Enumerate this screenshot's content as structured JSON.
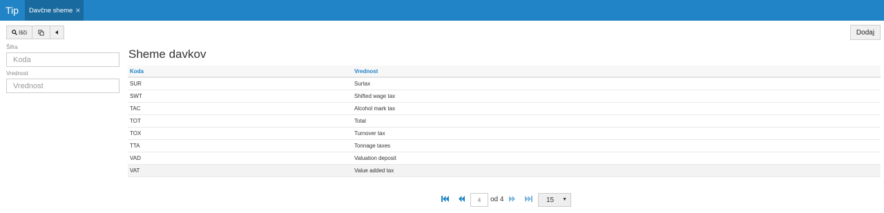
{
  "header": {
    "brand": "Tip",
    "tab_label": "Davčne sheme",
    "tab_close": "×"
  },
  "toolbar": {
    "search_label": "Išči",
    "add_label": "Dodaj"
  },
  "filters": {
    "code_label": "Šifra",
    "code_placeholder": "Koda",
    "value_label": "Vrednost",
    "value_placeholder": "Vrednost"
  },
  "main": {
    "title": "Sheme davkov",
    "columns": [
      "Koda",
      "Vrednost"
    ],
    "rows": [
      {
        "code": "SUR",
        "value": "Surtax"
      },
      {
        "code": "SWT",
        "value": "Shifted wage tax"
      },
      {
        "code": "TAC",
        "value": "Alcohol mark tax"
      },
      {
        "code": "TOT",
        "value": "Total"
      },
      {
        "code": "TOX",
        "value": "Turnover tax"
      },
      {
        "code": "TTA",
        "value": "Tonnage taxes"
      },
      {
        "code": "VAD",
        "value": "Valuation deposit"
      },
      {
        "code": "VAT",
        "value": "Value added tax"
      }
    ]
  },
  "pager": {
    "current_page": "4",
    "of_label": "od 4",
    "page_size": "15"
  },
  "colors": {
    "accent": "#2184c6",
    "tab_active": "#196a9f"
  }
}
